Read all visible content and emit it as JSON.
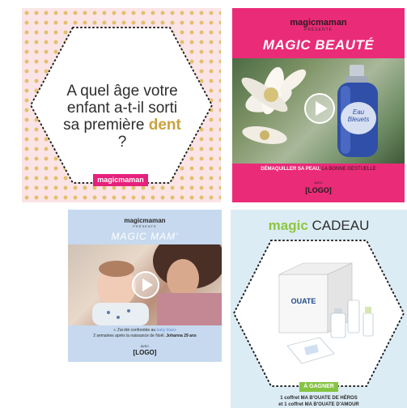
{
  "tiles": {
    "t1": {
      "question_part1": "A quel âge votre",
      "question_part2": "enfant a-t-il sorti",
      "question_part3": "sa première ",
      "question_highlight": "dent",
      "question_end": " ?",
      "brand": "magicmaman"
    },
    "t2": {
      "brand": "magicmaman",
      "presents": "PRÉSENTE",
      "title": "MAGIC BEAUTÉ",
      "caption_bold": "DÉMAQUILLER SA PEAU,",
      "caption_rest": " LA BONNE GESTUELLE",
      "avec": "AVEC",
      "logo": "[LOGO]",
      "product_label_1": "Eau",
      "product_label_2": "Bleuets"
    },
    "t3": {
      "brand": "magicmaman",
      "presents": "PRÉSENTE",
      "title": "MAGIC MAM'",
      "quote_prefix": "« J'ai été confrontée au ",
      "quote_highlight": "baby blues",
      "quote_suffix": " 2 semaines après la naissance de Noël. ",
      "quote_author": "Johanna 29 ans",
      "avec": "AVEC",
      "logo": "[LOGO]"
    },
    "t4": {
      "title_magic": "magic",
      "title_rest": " CADEAU",
      "box_label": "OUATE",
      "badge": "À GAGNER",
      "prize_line1": "1 coffret MA B'OUATE DE HÉROS",
      "prize_line2": "et 1 coffret MA B'OUATE D'AMOUR"
    }
  },
  "colors": {
    "pink_brand": "#e5217c",
    "magenta_bg": "#ea2b78",
    "gold_highlight": "#caa23f",
    "green_accent": "#84c442",
    "light_blue_bg": "#c6d9ef"
  },
  "icons": [
    "play-icon"
  ]
}
